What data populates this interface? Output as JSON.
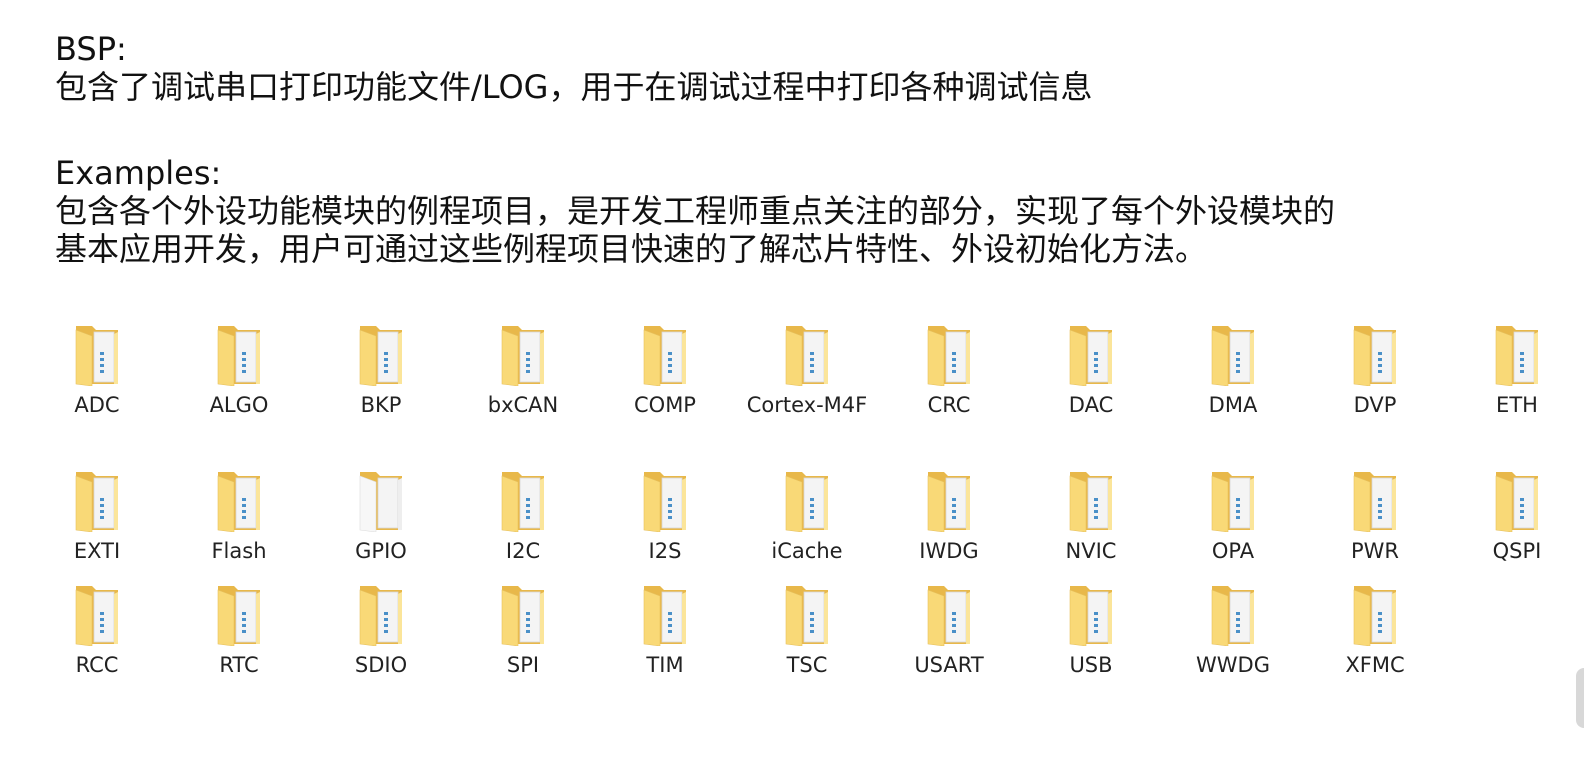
{
  "bsp": {
    "title": "BSP:",
    "description": "包含了调试串口打印功能文件/LOG，用于在调试过程中打印各种调试信息"
  },
  "examples": {
    "title": "Examples:",
    "description_line1": "包含各个外设功能模块的例程项目，是开发工程师重点关注的部分，实现了每个外设模块的",
    "description_line2": "基本应用开发，用户可通过这些例程项目快速的了解芯片特性、外设初始化方法。"
  },
  "folders": [
    {
      "name": "ADC",
      "icon": "folder-with-files-icon"
    },
    {
      "name": "ALGO",
      "icon": "folder-with-files-icon"
    },
    {
      "name": "BKP",
      "icon": "folder-with-files-icon"
    },
    {
      "name": "bxCAN",
      "icon": "folder-with-files-icon"
    },
    {
      "name": "COMP",
      "icon": "folder-with-files-icon"
    },
    {
      "name": "Cortex-M4F",
      "icon": "folder-with-files-icon"
    },
    {
      "name": "CRC",
      "icon": "folder-with-files-icon"
    },
    {
      "name": "DAC",
      "icon": "folder-with-files-icon"
    },
    {
      "name": "DMA",
      "icon": "folder-with-files-icon"
    },
    {
      "name": "DVP",
      "icon": "folder-with-files-icon"
    },
    {
      "name": "ETH",
      "icon": "folder-with-files-icon"
    },
    {
      "name": "EXTI",
      "icon": "folder-with-files-icon"
    },
    {
      "name": "Flash",
      "icon": "folder-with-files-icon"
    },
    {
      "name": "GPIO",
      "icon": "folder-with-paper-icon"
    },
    {
      "name": "I2C",
      "icon": "folder-with-files-icon"
    },
    {
      "name": "I2S",
      "icon": "folder-with-files-icon"
    },
    {
      "name": "iCache",
      "icon": "folder-with-files-icon"
    },
    {
      "name": "IWDG",
      "icon": "folder-with-files-icon"
    },
    {
      "name": "NVIC",
      "icon": "folder-with-files-icon"
    },
    {
      "name": "OPA",
      "icon": "folder-with-files-icon"
    },
    {
      "name": "PWR",
      "icon": "folder-with-files-icon"
    },
    {
      "name": "QSPI",
      "icon": "folder-with-files-icon"
    },
    {
      "name": "RCC",
      "icon": "folder-with-files-icon"
    },
    {
      "name": "RTC",
      "icon": "folder-with-files-icon"
    },
    {
      "name": "SDIO",
      "icon": "folder-with-files-icon"
    },
    {
      "name": "SPI",
      "icon": "folder-with-files-icon"
    },
    {
      "name": "TIM",
      "icon": "folder-with-files-icon"
    },
    {
      "name": "TSC",
      "icon": "folder-with-files-icon"
    },
    {
      "name": "USART",
      "icon": "folder-with-files-icon"
    },
    {
      "name": "USB",
      "icon": "folder-with-files-icon"
    },
    {
      "name": "WWDG",
      "icon": "folder-with-files-icon"
    },
    {
      "name": "XFMC",
      "icon": "folder-with-files-icon"
    }
  ],
  "colors": {
    "folder_back": "#e8b84a",
    "folder_front": "#f9d977",
    "folder_front_light": "#fbe59a",
    "paper": "#f4f4f4",
    "doc_accent": "#4a90c8"
  }
}
